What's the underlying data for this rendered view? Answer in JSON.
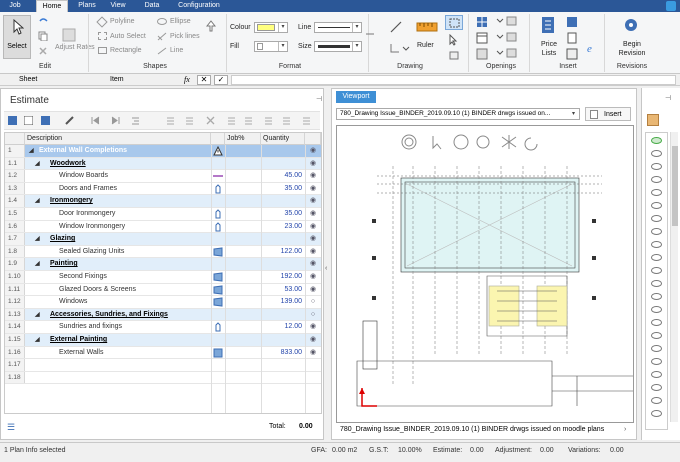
{
  "menu": [
    "Job",
    "Home",
    "Plans",
    "View",
    "Data",
    "Configuration"
  ],
  "ribbon": {
    "select": "Select",
    "adjust_rates": "Adjust Rates",
    "polyline": "Polyline",
    "auto_select": "Auto Select",
    "rectangle": "Rectangle",
    "ellipse": "Ellipse",
    "pick_lines": "Pick lines",
    "line": "Line",
    "colour": "Colour",
    "fill": "Fill",
    "line_label": "Line",
    "size_label": "Size",
    "ruler": "Ruler",
    "price_lists": "Price Lists",
    "begin_revision": "Begin Revision",
    "groups": [
      "Edit",
      "Shapes",
      "Format",
      "Drawing",
      "Openings",
      "Insert",
      "Revisions"
    ]
  },
  "formula_bar": {
    "sheet": "Sheet",
    "item": "Item",
    "fx": "fx"
  },
  "estimate": {
    "title": "Estimate",
    "columns": {
      "description": "Description",
      "job": "Job%",
      "quantity": "Quantity"
    },
    "rows": [
      {
        "num": "1",
        "desc": "External Wall Completions",
        "qty": "",
        "level": 0,
        "icon": "warning"
      },
      {
        "num": "1.1",
        "desc": "Woodwork",
        "qty": "",
        "level": 1
      },
      {
        "num": "1.2",
        "desc": "Window Boards",
        "qty": "45.00",
        "level": 2,
        "icon": "line"
      },
      {
        "num": "1.3",
        "desc": "Doors and Frames",
        "qty": "35.00",
        "level": 2,
        "icon": "hand"
      },
      {
        "num": "1.4",
        "desc": "Ironmongery",
        "qty": "",
        "level": 1
      },
      {
        "num": "1.5",
        "desc": "Door Ironmongery",
        "qty": "35.00",
        "level": 2,
        "icon": "hand"
      },
      {
        "num": "1.6",
        "desc": "Window Ironmongery",
        "qty": "23.00",
        "level": 2,
        "icon": "hand"
      },
      {
        "num": "1.7",
        "desc": "Glazing",
        "qty": "",
        "level": 1
      },
      {
        "num": "1.8",
        "desc": "Sealed Glazing Units",
        "qty": "122.00",
        "level": 2,
        "icon": "area"
      },
      {
        "num": "1.9",
        "desc": "Painting",
        "qty": "",
        "level": 1
      },
      {
        "num": "1.10",
        "desc": "Second Fixings",
        "qty": "192.00",
        "level": 2,
        "icon": "area"
      },
      {
        "num": "1.11",
        "desc": "Glazed Doors & Screens",
        "qty": "53.00",
        "level": 2,
        "icon": "area"
      },
      {
        "num": "1.12",
        "desc": "Windows",
        "qty": "139.00",
        "level": 2,
        "icon": "area"
      },
      {
        "num": "1.13",
        "desc": "Accessories, Sundries, and Fixings",
        "qty": "",
        "level": 1
      },
      {
        "num": "1.14",
        "desc": "Sundries and fixings",
        "qty": "12.00",
        "level": 2,
        "icon": "hand"
      },
      {
        "num": "1.15",
        "desc": "External Painting",
        "qty": "",
        "level": 1
      },
      {
        "num": "1.16",
        "desc": "External Walls",
        "qty": "833.00",
        "level": 2,
        "icon": "area2"
      },
      {
        "num": "1.17",
        "desc": "",
        "qty": "",
        "level": 3
      },
      {
        "num": "1.18",
        "desc": "",
        "qty": "",
        "level": 3
      }
    ],
    "total_label": "Total:",
    "total_value": "0.00"
  },
  "viewport": {
    "tab": "Viewport",
    "drawing_select": "780_Drawing Issue_BINDER_2019.09.10 (1) BINDER drwgs issued on...",
    "insert_button": "Insert",
    "footer": "780_Drawing Issue_BINDER_2019.09.10 (1) BINDER drwgs issued on moodle plans"
  },
  "status": {
    "left": "1 Plan Info selected",
    "gfa_label": "GFA:",
    "gfa": "0.00 m2",
    "gst_label": "G.S.T:",
    "gst": "10.00%",
    "estimate_label": "Estimate:",
    "estimate": "0.00",
    "adjustment_label": "Adjustment:",
    "adjustment": "0.00",
    "variations_label": "Variations:",
    "variations": "0.00"
  },
  "colors": {
    "menubar": "#2b5797",
    "header_row": "#a8c8ec",
    "sub_row": "#e1eefa",
    "qty_text": "#2244aa"
  }
}
